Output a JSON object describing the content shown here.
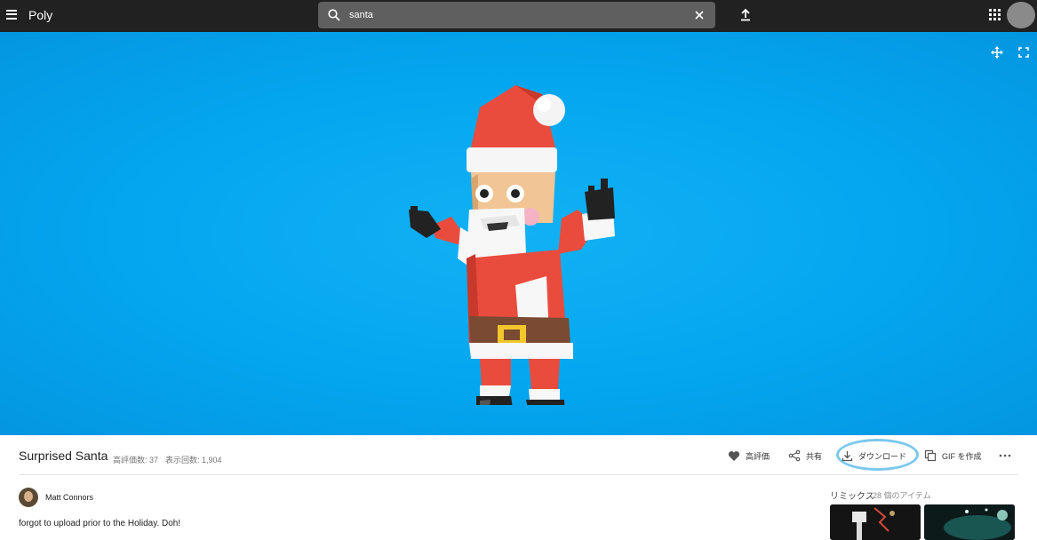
{
  "app": {
    "name": "Poly"
  },
  "search": {
    "value": "santa"
  },
  "model": {
    "title": "Surprised Santa",
    "likes": "高評価数: 37",
    "views": "表示回数: 1,904",
    "author": "Matt Connors",
    "description": "forgot to upload prior to the Holiday. Doh!"
  },
  "actions": {
    "like": "高評価",
    "share": "共有",
    "download": "ダウンロード",
    "gif": "GIF を作成"
  },
  "remix": {
    "label": "リミックス",
    "count": "28 個のアイテム"
  },
  "colors": {
    "topbar": "#212121",
    "viewer_bg": "#03a6ef",
    "highlight": "#7cc8ee"
  }
}
